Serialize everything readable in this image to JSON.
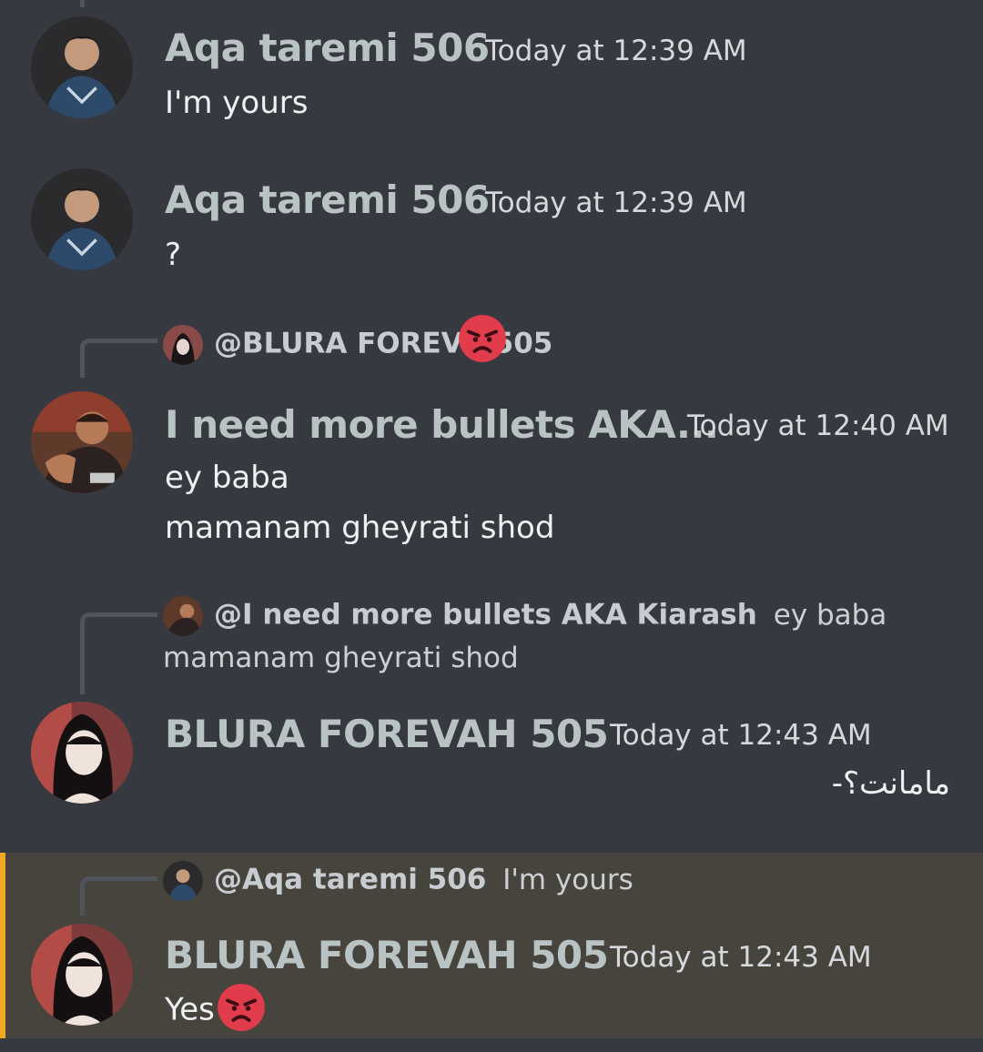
{
  "messages": [
    {
      "author": "Aqa taremi 506",
      "timestamp": "Today at 12:39 AM",
      "lines": [
        "I'm yours"
      ]
    },
    {
      "author": "Aqa taremi 506",
      "timestamp": "Today at 12:39 AM",
      "lines": [
        "?"
      ]
    },
    {
      "reply": {
        "mention": "@BLURA FOREVAH 505",
        "mention_visible": "@BLURA FOREV",
        "mention_tail": "505",
        "text": ""
      },
      "author": "I need more bullets AKA...",
      "timestamp": "Today at 12:40 AM",
      "lines": [
        "ey baba",
        "mamanam gheyrati shod"
      ]
    },
    {
      "reply": {
        "mention": "@I need more bullets AKA Kiarash",
        "text": "ey baba",
        "text2": "mamanam gheyrati shod"
      },
      "author": "BLURA FOREVAH 505",
      "timestamp": "Today at 12:43 AM",
      "lines": [
        "مامانت؟-"
      ]
    },
    {
      "reply": {
        "mention": "@Aqa taremi 506",
        "text": "I'm yours"
      },
      "author": "BLURA FOREVAH 505",
      "timestamp": "Today at 12:43 AM",
      "lines": [
        "Yes"
      ],
      "emoji": "angry-face-icon",
      "highlighted": true
    }
  ],
  "colors": {
    "background": "#36393f",
    "author": "#b9c3c3",
    "highlight_bg": "#47443d",
    "highlight_bar": "#f0a722"
  }
}
